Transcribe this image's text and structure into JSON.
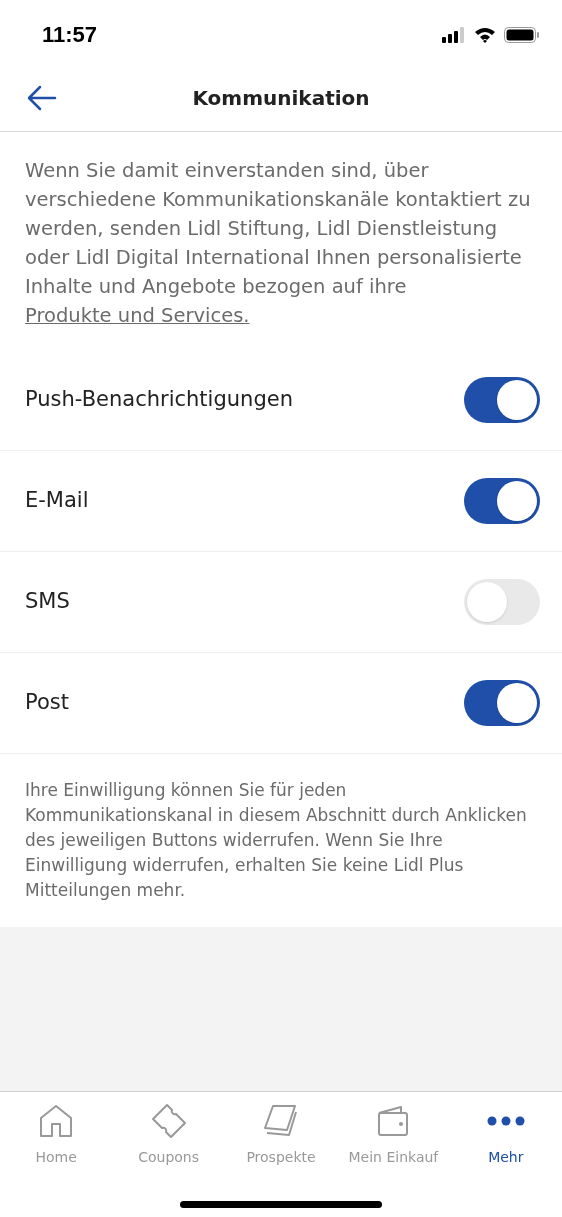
{
  "status_bar": {
    "time": "11:57"
  },
  "header": {
    "title": "Kommunikation"
  },
  "intro": {
    "text": "Wenn Sie damit einverstanden sind, über verschiedene Kommunikationskanäle kontaktiert zu werden, senden Lidl Stiftung, Lidl Dienstleistung oder Lidl Digital International Ihnen personalisierte Inhalte und Angebote bezogen auf ihre",
    "link": "Produkte und Services."
  },
  "channels": [
    {
      "label": "Push-Benachrichtigungen",
      "on": true
    },
    {
      "label": "E-Mail",
      "on": true
    },
    {
      "label": "SMS",
      "on": false
    },
    {
      "label": "Post",
      "on": true
    }
  ],
  "note": "Ihre Einwilligung können Sie für jeden Kommunikationskanal in diesem Abschnitt durch Anklicken des jeweiligen Buttons widerrufen. Wenn Sie Ihre Einwilligung widerrufen, erhalten Sie keine Lidl Plus Mitteilungen mehr.",
  "tab_bar": [
    {
      "label": "Home",
      "kind": "home",
      "selected": false
    },
    {
      "label": "Coupons",
      "kind": "coupon",
      "selected": false
    },
    {
      "label": "Prospekte",
      "kind": "brochure",
      "selected": false
    },
    {
      "label": "Mein Einkauf",
      "kind": "wallet",
      "selected": false
    },
    {
      "label": "Mehr",
      "kind": "more",
      "selected": true
    }
  ]
}
